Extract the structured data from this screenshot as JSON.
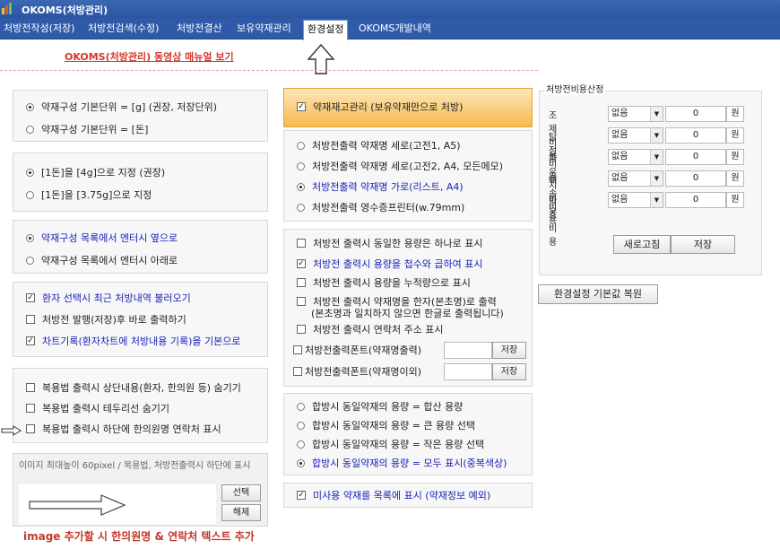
{
  "window": {
    "title": "OKOMS(처방관리)"
  },
  "menu": {
    "tabs": [
      {
        "label": "처방전작성(저장)"
      },
      {
        "label": "처방전검색(수정)"
      },
      {
        "label": "처방전결산"
      },
      {
        "label": "보유약재관리"
      },
      {
        "label": "환경설정"
      },
      {
        "label": "OKOMS개발내역"
      }
    ],
    "active_index": 4
  },
  "manual_link": "OKOMS(처방관리) 동영상 매뉴얼 보기",
  "left": {
    "unit_radios": [
      "약재구성 기본단위 = [g] (권장, 저장단위)",
      "약재구성 기본단위 = [돈]"
    ],
    "don_radios": [
      "[1돈]을 [4g]으로 지정 (권장)",
      "[1돈]을 [3.75g]으로 지정"
    ],
    "enter_radios": [
      "약재구성 목록에서 엔터시 옆으로",
      "약재구성 목록에서 엔터시 아래로"
    ],
    "patient_checks": [
      "환자 선택시 최근 처방내역 불러오기",
      "처방전 발행(저장)후 바로 출력하기",
      "차트기록(환자차트에 처방내용 기록)을 기본으로"
    ],
    "print_checks": [
      "복용법 출력시 상단내용(환자, 한의원 등) 숨기기",
      "복용법 출력시 테두리선 숨기기",
      "복용법 출력시 하단에 한의원명 연락처 표시"
    ],
    "image_note": "이미지 최대높이 60pixel / 복용법, 처방전출력시 하단에 표시",
    "select_btn": "선택",
    "clear_btn": "해제"
  },
  "middle": {
    "stock_check": "약재재고관리 (보유약재만으로 처방)",
    "output_radios": [
      "처방전출력  약재명 세로(고전1, A5)",
      "처방전출력  약재명 세로(고전2, A4, 모든메모)",
      "처방전출력  약재명 가로(리스트, A4)",
      "처방전출력  영수증프린터(w.79mm)"
    ],
    "output_checks": [
      "처방전 출력시 동일한 용량은 하나로 표시",
      "처방전 출력시 용량을 첩수와 곱하여 표시",
      "처방전 출력시 용량을 누적량으로 표시",
      "처방전 출력시 약재명을 한자(본초명)로 출력",
      "처방전 출력시 연락처 주소 표시"
    ],
    "hanja_note": "(본초명과 일치하지 않으면 한글로 출력됩니다)",
    "font_rows": [
      {
        "label": "처방전출력폰트(약재명출력)",
        "btn": "저장"
      },
      {
        "label": "처방전출력폰트(약재명이외)",
        "btn": "저장"
      }
    ],
    "combine_radios": [
      "합방시 동일약재의 용량 = 합산 용량",
      "합방시 동일약재의 용량 = 큰 용량 선택",
      "합방시 동일약재의 용량 = 작은 용량 선택",
      "합방시 동일약재의 용량 = 모두 표시(중복색상)"
    ],
    "unused_check": "미사용 약재를 목록에 표시 (약재정보 예외)"
  },
  "cost": {
    "title": "처방전비용산정",
    "rows": [
      {
        "label": "조제비용",
        "select": "없음",
        "value": "0",
        "unit": "원"
      },
      {
        "label": "탕전비용",
        "select": "없음",
        "value": "0",
        "unit": "원"
      },
      {
        "label": "파우치비용",
        "select": "없음",
        "value": "0",
        "unit": "원"
      },
      {
        "label": "배송비용",
        "select": "없음",
        "value": "0",
        "unit": "원"
      },
      {
        "label": "박스비용",
        "select": "없음",
        "value": "0",
        "unit": "원"
      }
    ],
    "refresh_btn": "새로고침",
    "save_btn": "저장"
  },
  "restore_btn": "환경설정 기본값 복원",
  "bottom_note": "image 추가할 시 한의원명 & 연락처 텍스트 추가",
  "colors": {
    "menu_bg": "#2f5aa8",
    "accent_red": "#d23a2e",
    "selected_blue": "#1a23b8",
    "orange": "#f6b94e"
  }
}
